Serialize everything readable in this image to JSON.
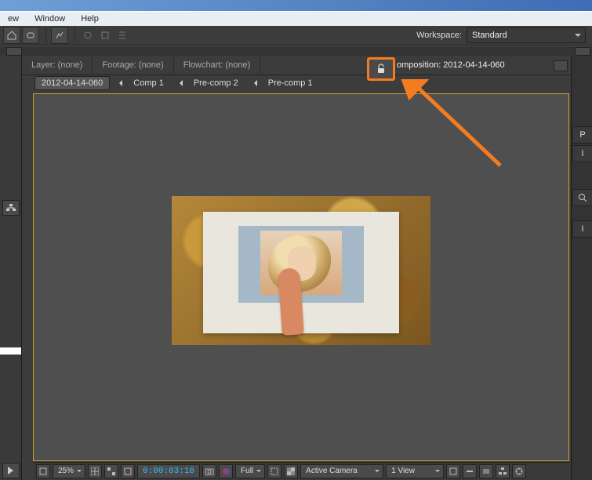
{
  "menubar": {
    "items": [
      "ew",
      "Window",
      "Help"
    ]
  },
  "workspace": {
    "label": "Workspace:",
    "value": "Standard"
  },
  "panel_tabs": {
    "layer": "Layer: (none)",
    "footage": "Footage: (none)",
    "flowchart": "Flowchart: (none)",
    "composition": "omposition: 2012-04-14-060"
  },
  "breadcrumb": {
    "items": [
      "2012-04-14-060",
      "Comp 1",
      "Pre-comp 2",
      "Pre-comp 1"
    ]
  },
  "view_controls": {
    "zoom": "25%",
    "timecode": "0:00:03:16",
    "resolution": "Full",
    "camera": "Active Camera",
    "views": "1 View"
  },
  "right_rail": {
    "letters": [
      "P",
      "I",
      "I"
    ]
  }
}
